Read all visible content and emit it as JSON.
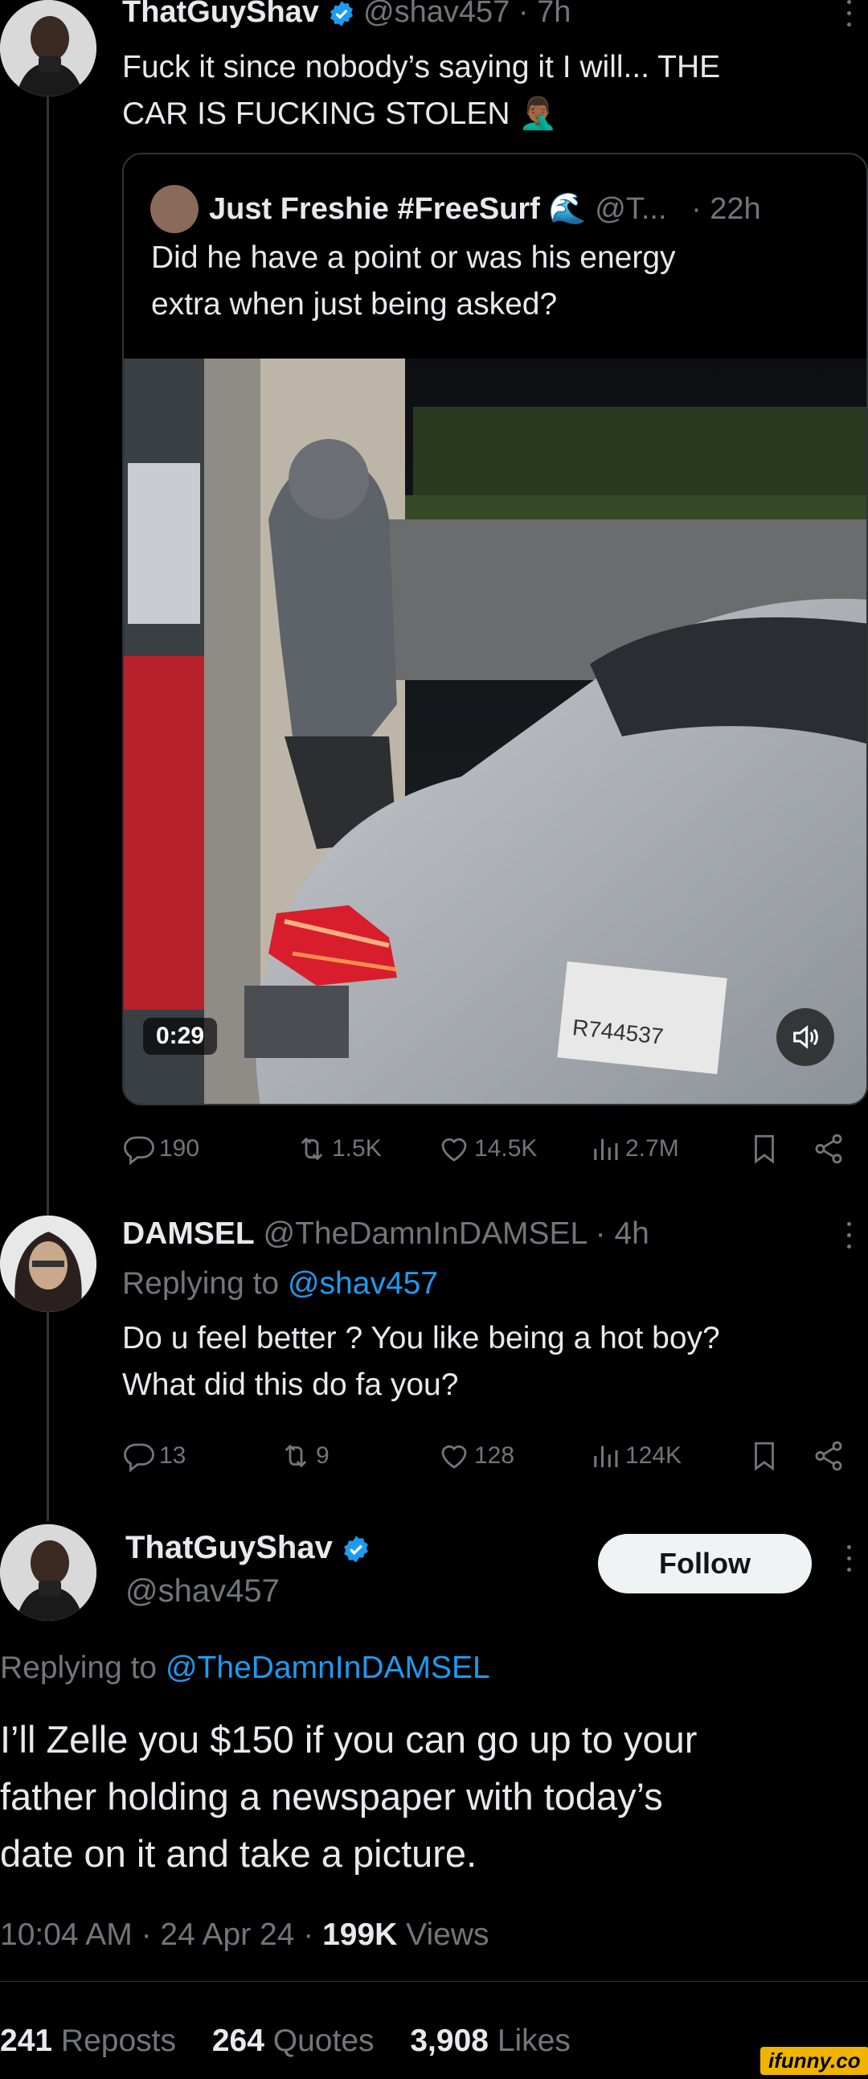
{
  "colors": {
    "background": "#000000",
    "text": "#e7e9ea",
    "muted": "#71767b",
    "link": "#1d9bf0",
    "verified": "#1d9bf0"
  },
  "tweet1": {
    "name": "ThatGuyShav",
    "handle": "@shav457",
    "dot": "·",
    "time": "7h",
    "text_line1": "Fuck it since nobody’s saying it I will... THE",
    "text_line2": "CAR IS FUCKING STOLEN 🤦🏾‍♂️",
    "quote": {
      "name": "Just Freshie #FreeSurf 🌊",
      "handle": "@T...",
      "time": "· 22h",
      "text_line1": "Did he have a point or was his energy",
      "text_line2": "extra when just being asked?",
      "video_duration": "0:29",
      "plate_text": "R744537"
    },
    "stats": {
      "replies": "190",
      "reposts": "1.5K",
      "likes": "14.5K",
      "views": "2.7M"
    }
  },
  "tweet2": {
    "name": "DAMSEL",
    "handle": "@TheDamnInDAMSEL",
    "time": "· 4h",
    "replying_prefix": "Replying to",
    "replying_to": "@shav457",
    "text_line1": "Do u feel better ? You like being a hot boy?",
    "text_line2": "What did this do fa you?",
    "stats": {
      "replies": "13",
      "reposts": "9",
      "likes": "128",
      "views": "124K"
    }
  },
  "tweet3": {
    "name": "ThatGuyShav",
    "handle": "@shav457",
    "follow_label": "Follow",
    "replying_prefix": "Replying to",
    "replying_to": "@TheDamnInDAMSEL",
    "text_line1": "I’ll Zelle you $150 if you can go up to your",
    "text_line2": "father holding a newspaper with today’s",
    "text_line3": "date on it and take a picture.",
    "time": "10:04 AM · 24 Apr 24 ·",
    "views_count": "199K",
    "views_label": "Views",
    "reposts_count": "241",
    "reposts_label": "Reposts",
    "quotes_count": "264",
    "quotes_label": "Quotes",
    "likes_count": "3,908",
    "likes_label": "Likes"
  },
  "watermark": "ifunny.co"
}
